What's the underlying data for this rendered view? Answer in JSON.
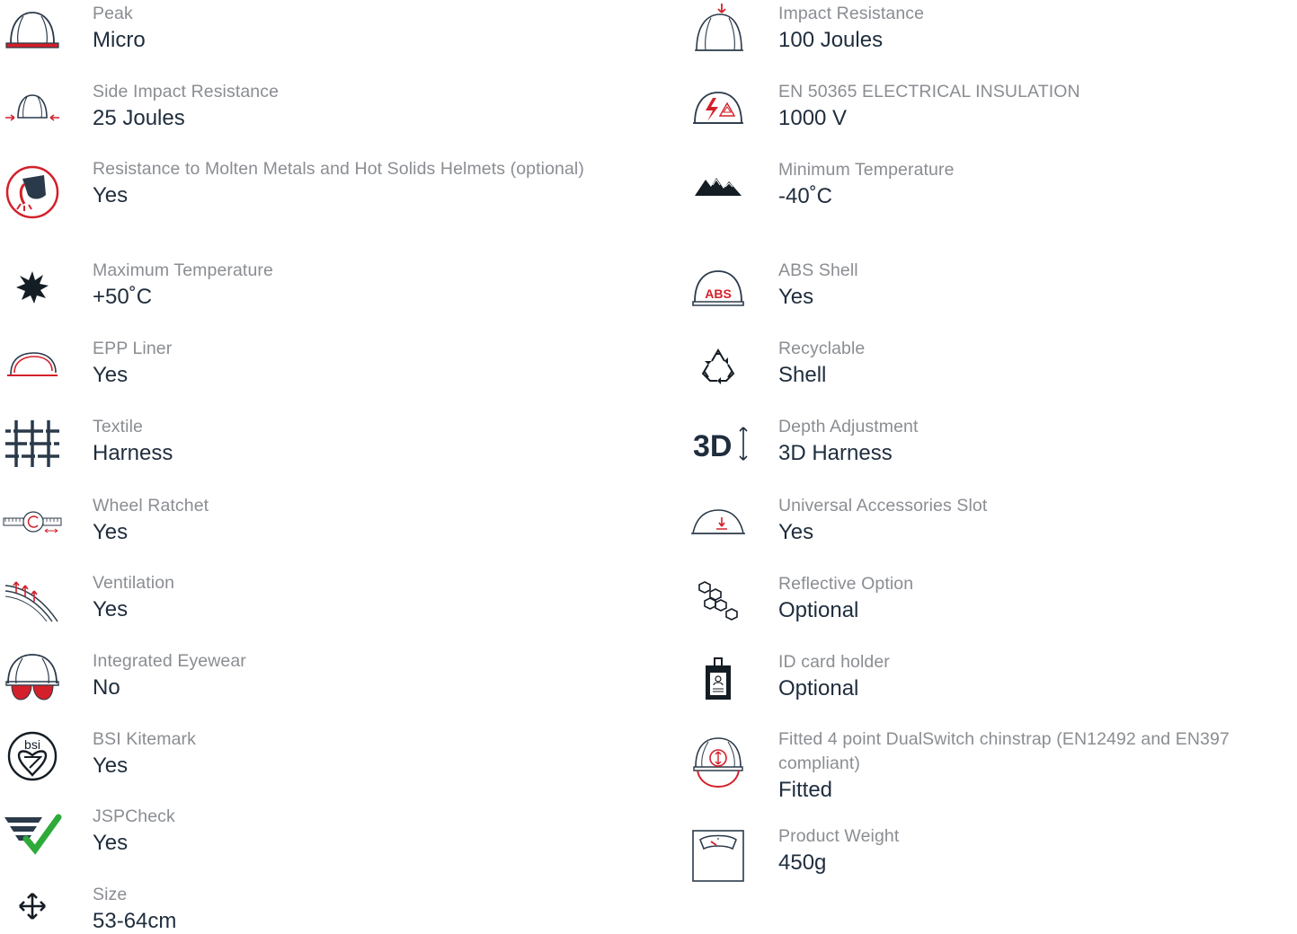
{
  "colors": {
    "label": "#8a8d92",
    "value": "#1f2d3d",
    "icon_dark": "#2b3a4a",
    "icon_red": "#d4202a",
    "icon_green": "#2eaa3a"
  },
  "left_column": [
    {
      "icon": "helmet-peak-icon",
      "label": "Peak",
      "value": "Micro"
    },
    {
      "icon": "side-impact-icon",
      "label": "Side Impact Resistance",
      "value": "25 Joules"
    },
    {
      "icon": "molten-metal-icon",
      "label": "Resistance to Molten Metals and Hot Solids Helmets (optional)",
      "value": "Yes"
    },
    {
      "icon": "sun-heat-icon",
      "label": "Maximum Temperature",
      "value": "+50˚C"
    },
    {
      "icon": "epp-liner-icon",
      "label": "EPP Liner",
      "value": "Yes"
    },
    {
      "icon": "textile-weave-icon",
      "label": "Textile",
      "value": "Harness"
    },
    {
      "icon": "wheel-ratchet-icon",
      "label": "Wheel Ratchet",
      "value": "Yes"
    },
    {
      "icon": "ventilation-icon",
      "label": "Ventilation",
      "value": "Yes"
    },
    {
      "icon": "integrated-eyewear-icon",
      "label": "Integrated Eyewear",
      "value": "No"
    },
    {
      "icon": "bsi-kitemark-icon",
      "label": "BSI Kitemark",
      "value": "Yes"
    },
    {
      "icon": "jspcheck-icon",
      "label": "JSPCheck",
      "value": "Yes"
    },
    {
      "icon": "size-arrows-icon",
      "label": "Size",
      "value": "53-64cm"
    }
  ],
  "right_column": [
    {
      "icon": "impact-resistance-icon",
      "label": "Impact Resistance",
      "value": "100 Joules"
    },
    {
      "icon": "electrical-insulation-icon",
      "label": "EN 50365 ELECTRICAL INSULATION",
      "value": "1000 V"
    },
    {
      "icon": "mountains-cold-icon",
      "label": "Minimum Temperature",
      "value": "-40˚C"
    },
    {
      "icon": "abs-shell-icon",
      "label": "ABS Shell",
      "value": "Yes",
      "icon_text": "ABS"
    },
    {
      "icon": "recycle-icon",
      "label": "Recyclable",
      "value": "Shell"
    },
    {
      "icon": "depth-3d-icon",
      "label": "Depth Adjustment",
      "value": "3D Harness",
      "icon_text": "3D"
    },
    {
      "icon": "accessory-slot-icon",
      "label": "Universal Accessories Slot",
      "value": "Yes"
    },
    {
      "icon": "reflective-hexagon-icon",
      "label": "Reflective Option",
      "value": "Optional"
    },
    {
      "icon": "id-card-holder-icon",
      "label": "ID card holder",
      "value": "Optional"
    },
    {
      "icon": "chinstrap-icon",
      "label": "Fitted 4 point DualSwitch chinstrap (EN12492 and EN397 compliant)",
      "value": "Fitted"
    },
    {
      "icon": "weight-scale-icon",
      "label": "Product Weight",
      "value": "450g"
    }
  ]
}
